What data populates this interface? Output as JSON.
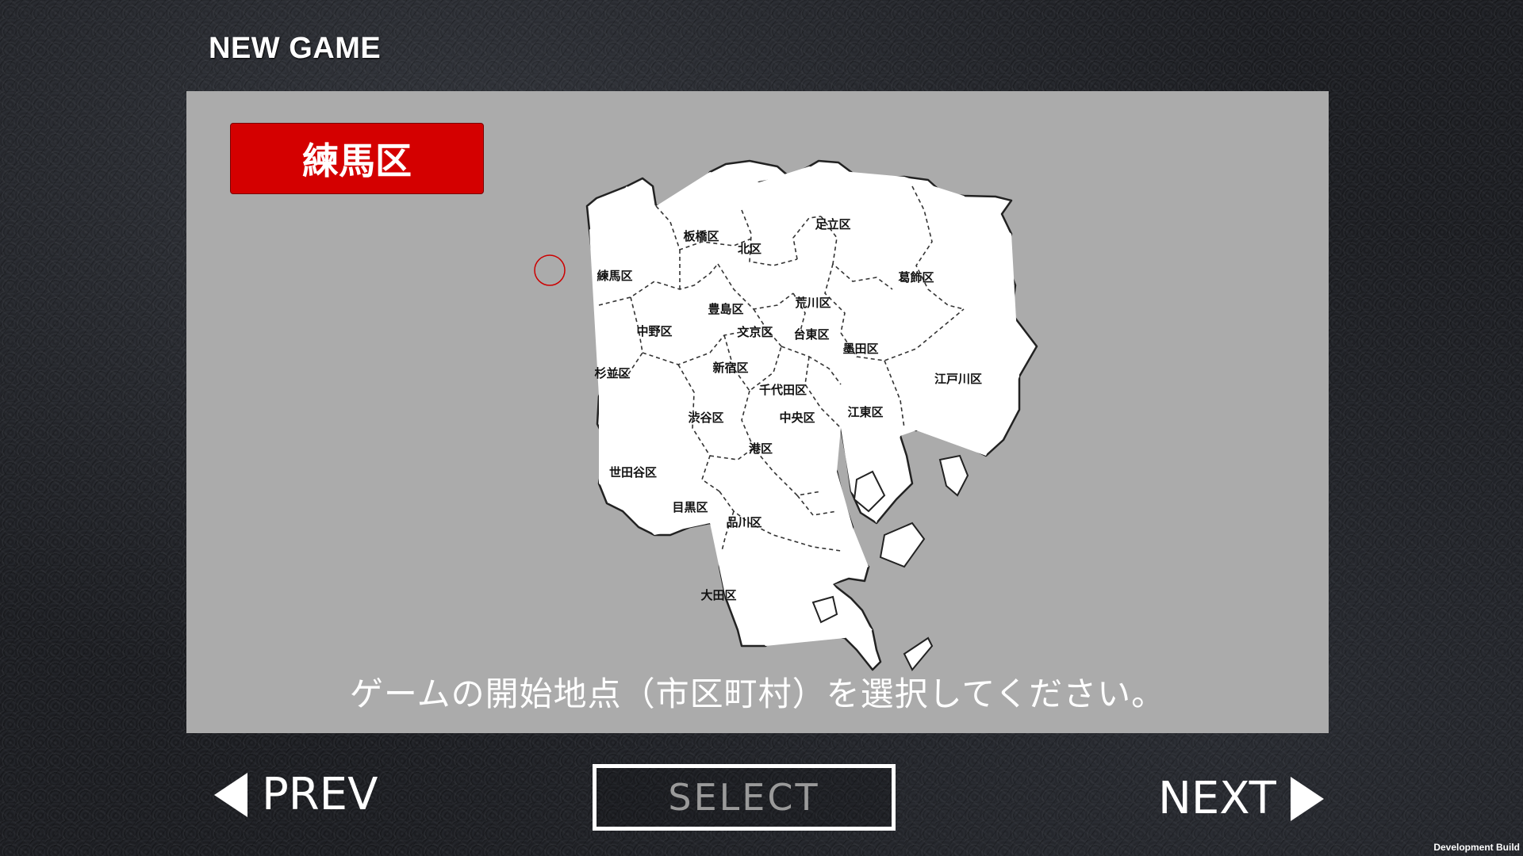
{
  "screen": {
    "title": "NEW GAME",
    "selected_ward": "練馬区",
    "instruction": "ゲームの開始地点（市区町村）を選択してください。"
  },
  "wards": [
    {
      "id": "adachi",
      "label": "足立区"
    },
    {
      "id": "itabashi",
      "label": "板橋区"
    },
    {
      "id": "kita",
      "label": "北区"
    },
    {
      "id": "katsushika",
      "label": "葛飾区"
    },
    {
      "id": "nerima",
      "label": "練馬区"
    },
    {
      "id": "arakawa",
      "label": "荒川区"
    },
    {
      "id": "toshima",
      "label": "豊島区"
    },
    {
      "id": "nakano",
      "label": "中野区"
    },
    {
      "id": "bunkyo",
      "label": "文京区"
    },
    {
      "id": "taito",
      "label": "台東区"
    },
    {
      "id": "sumida",
      "label": "墨田区"
    },
    {
      "id": "suginami",
      "label": "杉並区"
    },
    {
      "id": "shinjuku",
      "label": "新宿区"
    },
    {
      "id": "edogawa",
      "label": "江戸川区"
    },
    {
      "id": "chiyoda",
      "label": "千代田区"
    },
    {
      "id": "koto",
      "label": "江東区"
    },
    {
      "id": "shibuya",
      "label": "渋谷区"
    },
    {
      "id": "chuo",
      "label": "中央区"
    },
    {
      "id": "minato",
      "label": "港区"
    },
    {
      "id": "setagaya",
      "label": "世田谷区"
    },
    {
      "id": "meguro",
      "label": "目黒区"
    },
    {
      "id": "shinagawa",
      "label": "品川区"
    },
    {
      "id": "ota",
      "label": "大田区"
    }
  ],
  "nav": {
    "prev_label": "PREV",
    "select_label": "SELECT",
    "next_label": "NEXT"
  },
  "footer": {
    "dev_build": "Development Build"
  },
  "colors": {
    "badge": "#d40000",
    "panel": "#ababab",
    "map_fill": "#ffffff",
    "selection_marker": "#cc0000"
  }
}
